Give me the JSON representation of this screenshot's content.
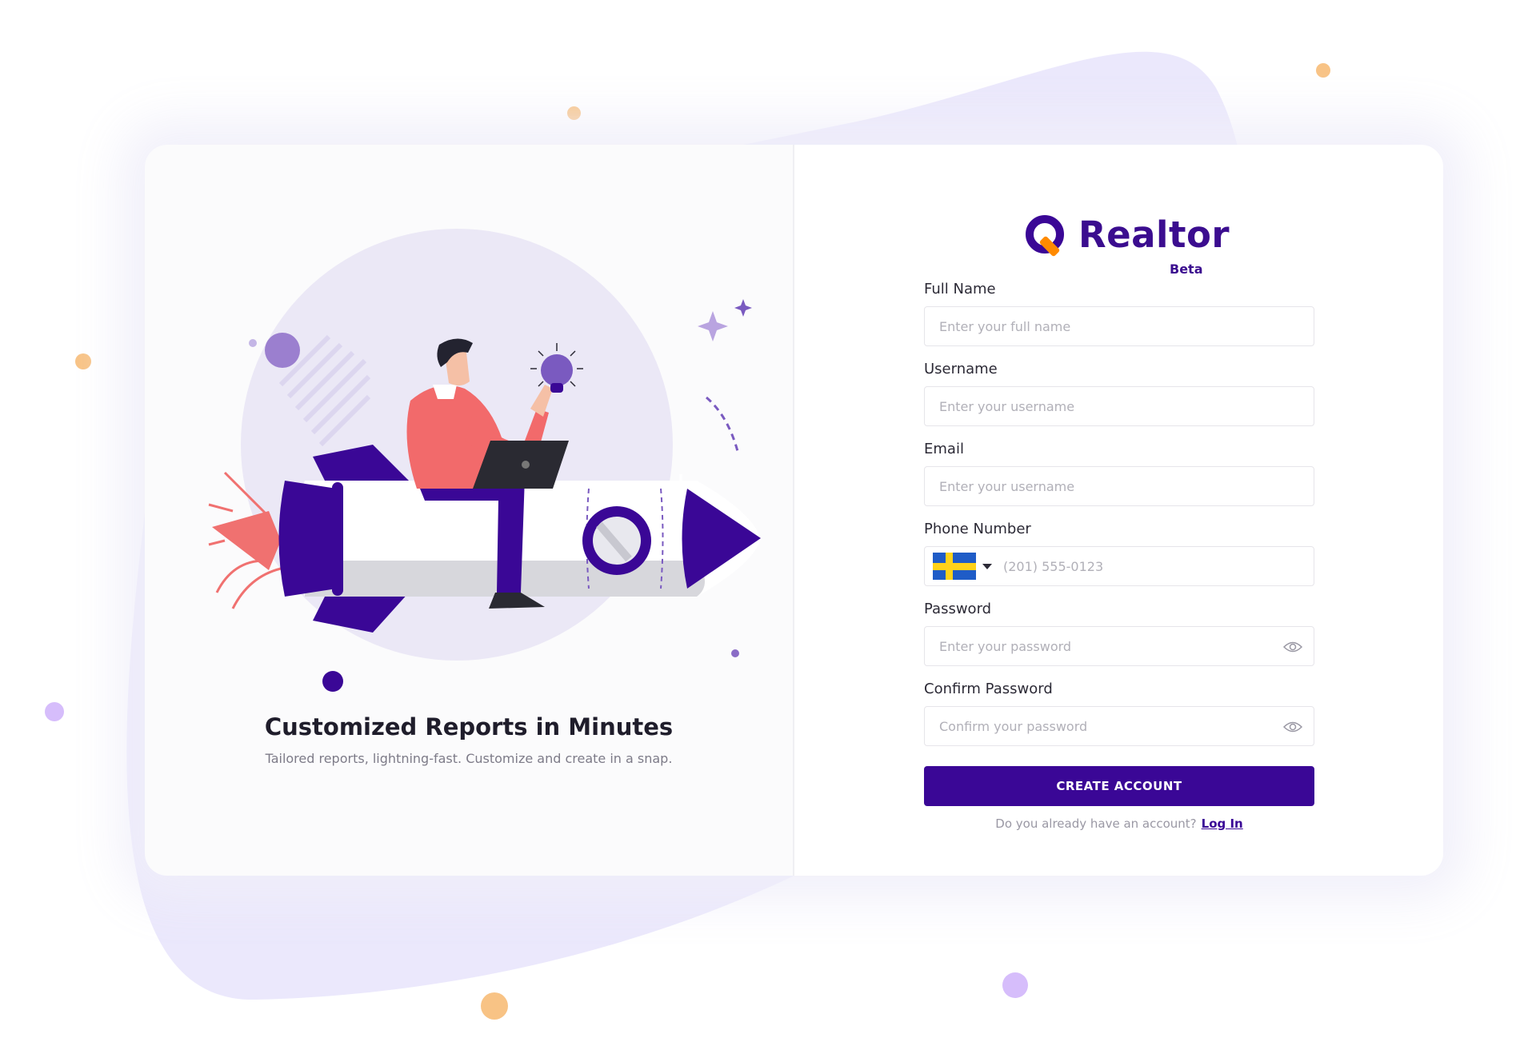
{
  "colors": {
    "brand": "#3a0796",
    "blob": "#ebe8fc",
    "dot_orange": "#f8c385",
    "dot_purple": "#d6bdfb"
  },
  "promo": {
    "title": "Customized Reports in Minutes",
    "subtitle": "Tailored reports, lightning-fast. Customize and create in a snap."
  },
  "logo": {
    "name": "Realtor",
    "badge": "Beta"
  },
  "form": {
    "full_name": {
      "label": "Full Name",
      "placeholder": "Enter your full name"
    },
    "username": {
      "label": "Username",
      "placeholder": "Enter your username"
    },
    "email": {
      "label": "Email",
      "placeholder": "Enter your username"
    },
    "phone": {
      "label": "Phone Number",
      "placeholder": "(201) 555-0123",
      "country_flag": "sweden-flag-icon"
    },
    "password": {
      "label": "Password",
      "placeholder": "Enter your password"
    },
    "confirm_password": {
      "label": "Confirm Password",
      "placeholder": "Confirm your password"
    },
    "submit_label": "CREATE ACCOUNT",
    "login_prompt": "Do you already have an account?",
    "login_link": "Log In"
  }
}
